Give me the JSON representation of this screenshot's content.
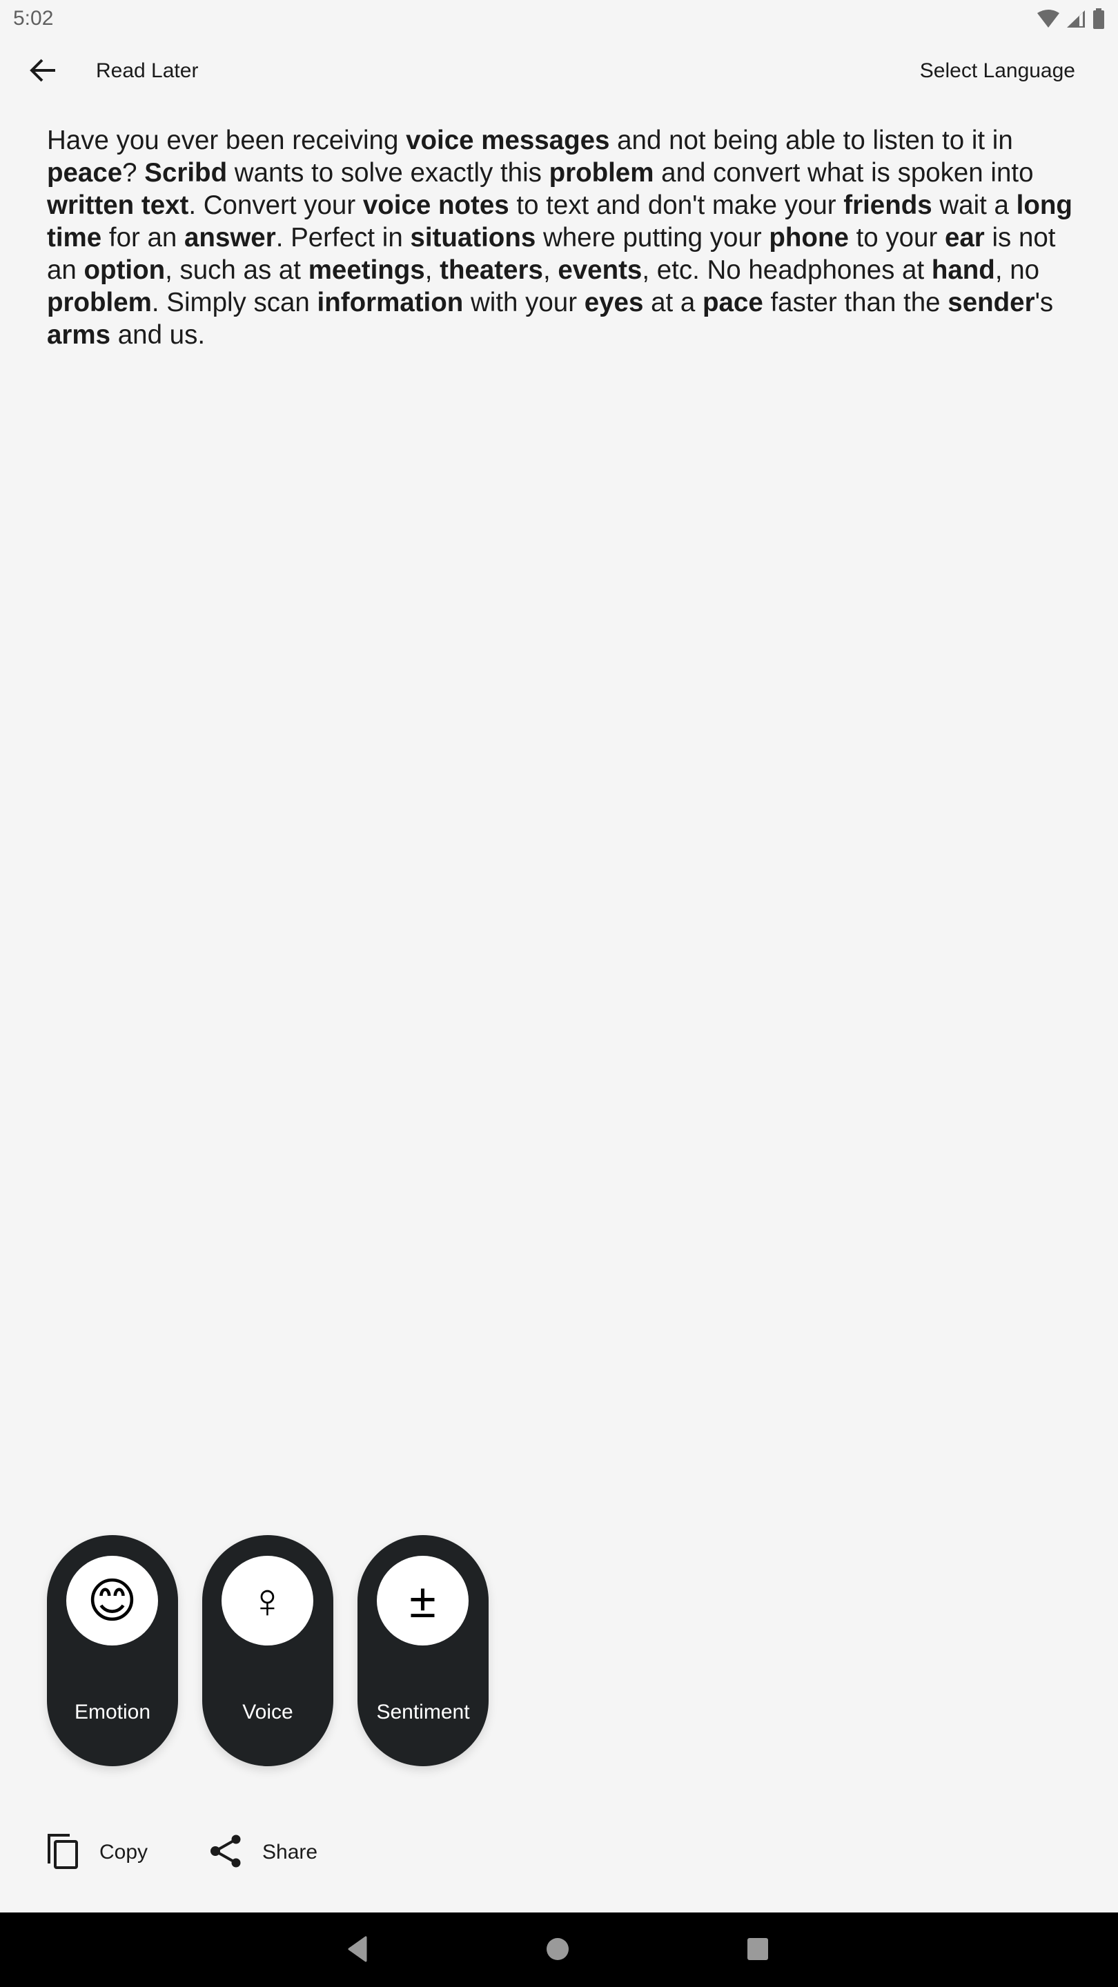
{
  "status_bar": {
    "time": "5:02",
    "icons": [
      "wifi-icon",
      "cellular-signal-icon",
      "battery-icon"
    ]
  },
  "toolbar": {
    "back_icon": "arrow-left-icon",
    "title": "Read Later",
    "select_language_label": "Select Language"
  },
  "content": {
    "segments": [
      {
        "t": "Have you ever been receiving "
      },
      {
        "b": "voice messages"
      },
      {
        "t": " and not being able to listen to it in "
      },
      {
        "b": "peace"
      },
      {
        "t": "? "
      },
      {
        "b": "Scribd"
      },
      {
        "t": " wants to solve exactly this "
      },
      {
        "b": "problem"
      },
      {
        "t": " and convert what is spoken into "
      },
      {
        "b": "written text"
      },
      {
        "t": ". Convert your "
      },
      {
        "b": "voice notes"
      },
      {
        "t": " to text and don't make your "
      },
      {
        "b": "friends"
      },
      {
        "t": " wait a "
      },
      {
        "b": "long time"
      },
      {
        "t": " for an "
      },
      {
        "b": "answer"
      },
      {
        "t": ". Perfect in "
      },
      {
        "b": "situations"
      },
      {
        "t": " where putting your "
      },
      {
        "b": "phone"
      },
      {
        "t": " to your "
      },
      {
        "b": "ear"
      },
      {
        "t": " is not an "
      },
      {
        "b": "option"
      },
      {
        "t": ", such as at "
      },
      {
        "b": "meetings"
      },
      {
        "t": ", "
      },
      {
        "b": "theaters"
      },
      {
        "t": ", "
      },
      {
        "b": "events"
      },
      {
        "t": ", etc. No headphones at "
      },
      {
        "b": "hand"
      },
      {
        "t": ", no "
      },
      {
        "b": "problem"
      },
      {
        "t": ". Simply scan "
      },
      {
        "b": "information"
      },
      {
        "t": " with your "
      },
      {
        "b": "eyes"
      },
      {
        "t": " at a "
      },
      {
        "b": "pace"
      },
      {
        "t": " faster than the "
      },
      {
        "b": "sender"
      },
      {
        "t": "'s "
      },
      {
        "b": "arms"
      },
      {
        "t": " and us."
      }
    ]
  },
  "analysis_buttons": [
    {
      "label": "Emotion",
      "icon": "smiling-face-emoji-icon",
      "glyph": "😊"
    },
    {
      "label": "Voice",
      "icon": "female-symbol-icon",
      "glyph": "♀"
    },
    {
      "label": "Sentiment",
      "icon": "plus-minus-icon",
      "glyph": "±"
    }
  ],
  "actions": {
    "copy_label": "Copy",
    "share_label": "Share"
  },
  "nav_bar": {
    "icons": [
      "back-triangle-icon",
      "home-circle-icon",
      "recents-square-icon"
    ]
  },
  "colors": {
    "background": "#f5f5f5",
    "pill": "#1f2224",
    "text": "#1b1b1b",
    "nav_bar": "#000000",
    "nav_icons": "#9a9a9a"
  }
}
